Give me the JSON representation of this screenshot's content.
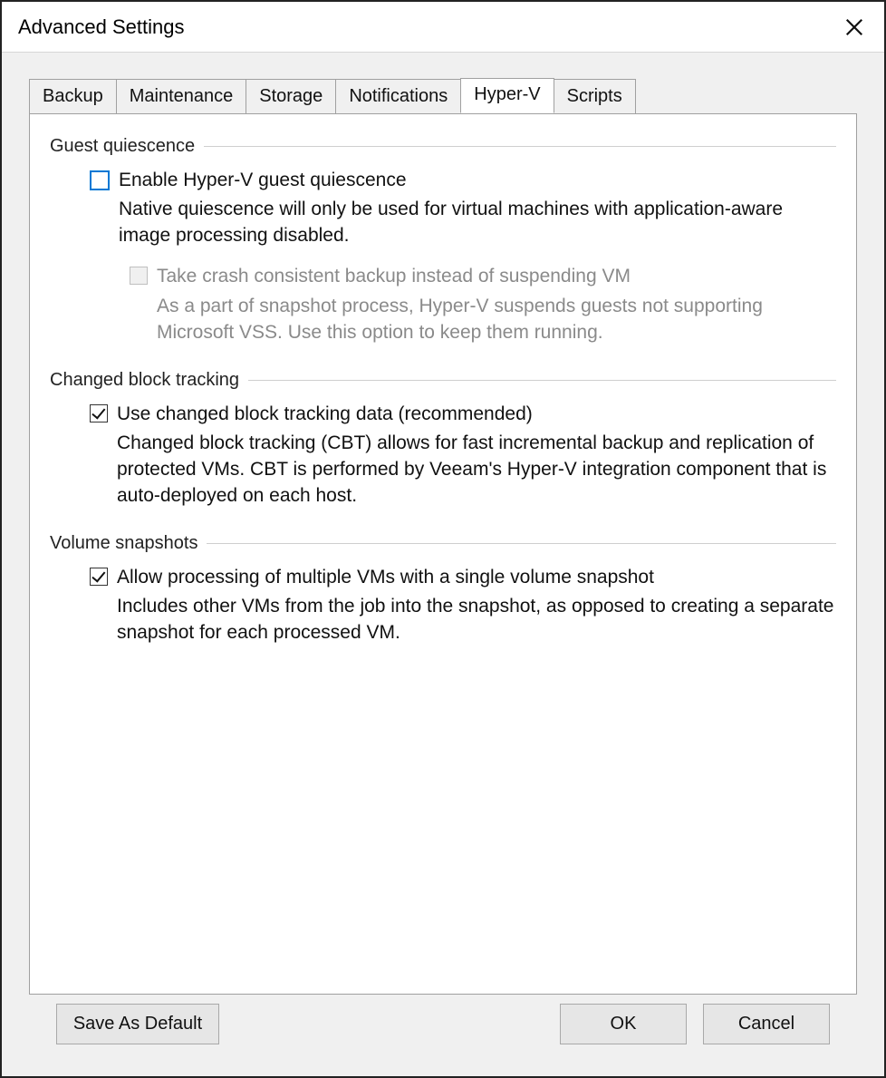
{
  "window": {
    "title": "Advanced Settings"
  },
  "tabs": [
    {
      "label": "Backup"
    },
    {
      "label": "Maintenance"
    },
    {
      "label": "Storage"
    },
    {
      "label": "Notifications"
    },
    {
      "label": "Hyper-V"
    },
    {
      "label": "Scripts"
    }
  ],
  "hyperv": {
    "guest_quiescence": {
      "header": "Guest quiescence",
      "enable_label": "Enable Hyper-V guest quiescence",
      "enable_desc": "Native quiescence will only be used for virtual machines with application-aware image processing disabled.",
      "crash_label": "Take crash consistent backup instead of suspending VM",
      "crash_desc": "As a part of snapshot process, Hyper-V suspends guests not supporting Microsoft VSS. Use this option to keep them running."
    },
    "cbt": {
      "header": "Changed block tracking",
      "use_label": "Use changed block tracking data (recommended)",
      "use_desc": "Changed block tracking (CBT) allows for fast incremental backup and replication of protected VMs. CBT is performed by Veeam's Hyper-V integration component that is auto-deployed on each host."
    },
    "volume_snapshots": {
      "header": "Volume snapshots",
      "allow_label": "Allow processing of multiple VMs with a single volume snapshot",
      "allow_desc": "Includes other VMs from the job into the snapshot, as opposed to creating a separate snapshot for each processed VM."
    }
  },
  "buttons": {
    "save_default": "Save As Default",
    "ok": "OK",
    "cancel": "Cancel"
  }
}
